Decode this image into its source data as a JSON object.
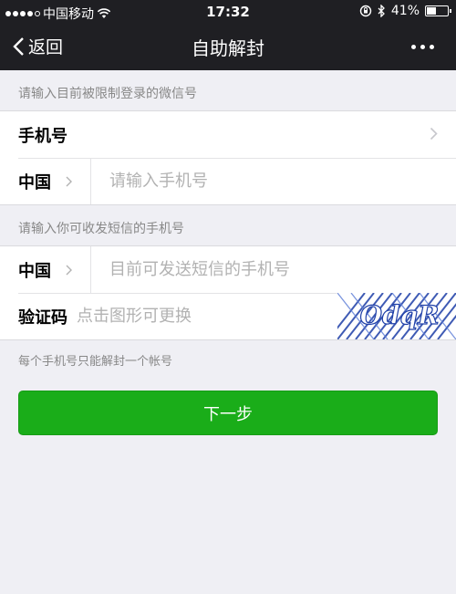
{
  "status_bar": {
    "carrier": "中国移动",
    "time": "17:32",
    "battery": "41%"
  },
  "nav": {
    "back_label": "返回",
    "title": "自助解封"
  },
  "section1": {
    "hint": "请输入目前被限制登录的微信号",
    "account_row_label": "手机号",
    "country": "中国",
    "phone_placeholder": "请输入手机号"
  },
  "section2": {
    "hint": "请输入你可收发短信的手机号",
    "country": "中国",
    "phone_placeholder": "目前可发送短信的手机号",
    "code_label": "验证码",
    "code_placeholder": "点击图形可更换",
    "captcha_text": "OdqR"
  },
  "note": "每个手机号只能解封一个帐号",
  "next_button": "下一步",
  "colors": {
    "nav_bg": "#1f1f23",
    "page_bg": "#efeff4",
    "button_green": "#1aad19"
  }
}
